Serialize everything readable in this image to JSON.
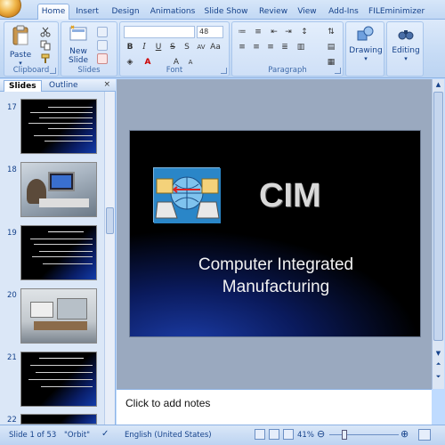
{
  "ribbon": {
    "tabs": [
      "Home",
      "Insert",
      "Design",
      "Animations",
      "Slide Show",
      "Review",
      "View",
      "Add-Ins",
      "FILEminimizer"
    ],
    "active_tab": "Home",
    "groups": {
      "clipboard": {
        "label": "Clipboard",
        "paste": "Paste"
      },
      "slides": {
        "label": "Slides",
        "new_slide_line1": "New",
        "new_slide_line2": "Slide"
      },
      "font": {
        "label": "Font",
        "font_name": "",
        "font_size": "48"
      },
      "paragraph": {
        "label": "Paragraph"
      },
      "drawing": {
        "label": "Drawing"
      },
      "editing": {
        "label": "Editing"
      }
    }
  },
  "slides_pane": {
    "tabs": [
      "Slides",
      "Outline"
    ],
    "active_tab": "Slides",
    "close_glyph": "×",
    "thumbnails": [
      {
        "number": "17",
        "kind": "text"
      },
      {
        "number": "18",
        "kind": "photo"
      },
      {
        "number": "19",
        "kind": "text"
      },
      {
        "number": "20",
        "kind": "photo"
      },
      {
        "number": "21",
        "kind": "text"
      },
      {
        "number": "22",
        "kind": "text"
      }
    ]
  },
  "slide": {
    "title": "CIM",
    "subtitle_line1": "Computer Integrated",
    "subtitle_line2": "Manufacturing"
  },
  "notes": {
    "placeholder": "Click to add notes"
  },
  "status_bar": {
    "slide_info": "Slide 1 of 53",
    "theme": "\"Orbit\"",
    "language": "English (United States)",
    "zoom": "41%"
  },
  "colors": {
    "ribbon_bg": "#c6dbf5",
    "slide_bg": "#000000",
    "accent_blue": "#1c3da8"
  }
}
